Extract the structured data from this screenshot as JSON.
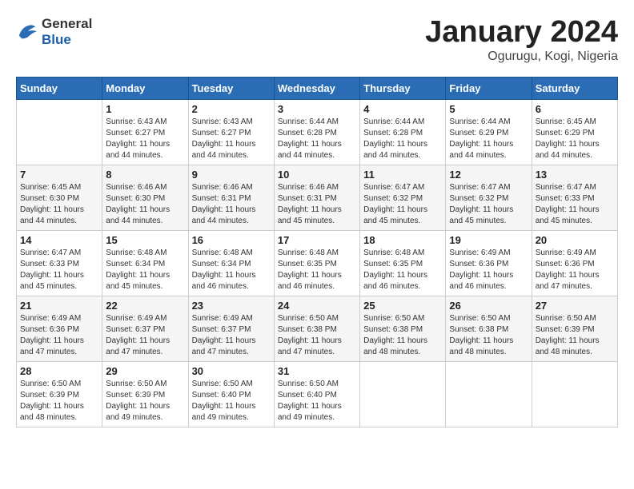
{
  "header": {
    "logo_general": "General",
    "logo_blue": "Blue",
    "month_title": "January 2024",
    "location": "Ogurugu, Kogi, Nigeria"
  },
  "days_of_week": [
    "Sunday",
    "Monday",
    "Tuesday",
    "Wednesday",
    "Thursday",
    "Friday",
    "Saturday"
  ],
  "weeks": [
    [
      {
        "day": "",
        "info": ""
      },
      {
        "day": "1",
        "info": "Sunrise: 6:43 AM\nSunset: 6:27 PM\nDaylight: 11 hours\nand 44 minutes."
      },
      {
        "day": "2",
        "info": "Sunrise: 6:43 AM\nSunset: 6:27 PM\nDaylight: 11 hours\nand 44 minutes."
      },
      {
        "day": "3",
        "info": "Sunrise: 6:44 AM\nSunset: 6:28 PM\nDaylight: 11 hours\nand 44 minutes."
      },
      {
        "day": "4",
        "info": "Sunrise: 6:44 AM\nSunset: 6:28 PM\nDaylight: 11 hours\nand 44 minutes."
      },
      {
        "day": "5",
        "info": "Sunrise: 6:44 AM\nSunset: 6:29 PM\nDaylight: 11 hours\nand 44 minutes."
      },
      {
        "day": "6",
        "info": "Sunrise: 6:45 AM\nSunset: 6:29 PM\nDaylight: 11 hours\nand 44 minutes."
      }
    ],
    [
      {
        "day": "7",
        "info": "Sunrise: 6:45 AM\nSunset: 6:30 PM\nDaylight: 11 hours\nand 44 minutes."
      },
      {
        "day": "8",
        "info": "Sunrise: 6:46 AM\nSunset: 6:30 PM\nDaylight: 11 hours\nand 44 minutes."
      },
      {
        "day": "9",
        "info": "Sunrise: 6:46 AM\nSunset: 6:31 PM\nDaylight: 11 hours\nand 44 minutes."
      },
      {
        "day": "10",
        "info": "Sunrise: 6:46 AM\nSunset: 6:31 PM\nDaylight: 11 hours\nand 45 minutes."
      },
      {
        "day": "11",
        "info": "Sunrise: 6:47 AM\nSunset: 6:32 PM\nDaylight: 11 hours\nand 45 minutes."
      },
      {
        "day": "12",
        "info": "Sunrise: 6:47 AM\nSunset: 6:32 PM\nDaylight: 11 hours\nand 45 minutes."
      },
      {
        "day": "13",
        "info": "Sunrise: 6:47 AM\nSunset: 6:33 PM\nDaylight: 11 hours\nand 45 minutes."
      }
    ],
    [
      {
        "day": "14",
        "info": "Sunrise: 6:47 AM\nSunset: 6:33 PM\nDaylight: 11 hours\nand 45 minutes."
      },
      {
        "day": "15",
        "info": "Sunrise: 6:48 AM\nSunset: 6:34 PM\nDaylight: 11 hours\nand 45 minutes."
      },
      {
        "day": "16",
        "info": "Sunrise: 6:48 AM\nSunset: 6:34 PM\nDaylight: 11 hours\nand 46 minutes."
      },
      {
        "day": "17",
        "info": "Sunrise: 6:48 AM\nSunset: 6:35 PM\nDaylight: 11 hours\nand 46 minutes."
      },
      {
        "day": "18",
        "info": "Sunrise: 6:48 AM\nSunset: 6:35 PM\nDaylight: 11 hours\nand 46 minutes."
      },
      {
        "day": "19",
        "info": "Sunrise: 6:49 AM\nSunset: 6:36 PM\nDaylight: 11 hours\nand 46 minutes."
      },
      {
        "day": "20",
        "info": "Sunrise: 6:49 AM\nSunset: 6:36 PM\nDaylight: 11 hours\nand 47 minutes."
      }
    ],
    [
      {
        "day": "21",
        "info": "Sunrise: 6:49 AM\nSunset: 6:36 PM\nDaylight: 11 hours\nand 47 minutes."
      },
      {
        "day": "22",
        "info": "Sunrise: 6:49 AM\nSunset: 6:37 PM\nDaylight: 11 hours\nand 47 minutes."
      },
      {
        "day": "23",
        "info": "Sunrise: 6:49 AM\nSunset: 6:37 PM\nDaylight: 11 hours\nand 47 minutes."
      },
      {
        "day": "24",
        "info": "Sunrise: 6:50 AM\nSunset: 6:38 PM\nDaylight: 11 hours\nand 47 minutes."
      },
      {
        "day": "25",
        "info": "Sunrise: 6:50 AM\nSunset: 6:38 PM\nDaylight: 11 hours\nand 48 minutes."
      },
      {
        "day": "26",
        "info": "Sunrise: 6:50 AM\nSunset: 6:38 PM\nDaylight: 11 hours\nand 48 minutes."
      },
      {
        "day": "27",
        "info": "Sunrise: 6:50 AM\nSunset: 6:39 PM\nDaylight: 11 hours\nand 48 minutes."
      }
    ],
    [
      {
        "day": "28",
        "info": "Sunrise: 6:50 AM\nSunset: 6:39 PM\nDaylight: 11 hours\nand 48 minutes."
      },
      {
        "day": "29",
        "info": "Sunrise: 6:50 AM\nSunset: 6:39 PM\nDaylight: 11 hours\nand 49 minutes."
      },
      {
        "day": "30",
        "info": "Sunrise: 6:50 AM\nSunset: 6:40 PM\nDaylight: 11 hours\nand 49 minutes."
      },
      {
        "day": "31",
        "info": "Sunrise: 6:50 AM\nSunset: 6:40 PM\nDaylight: 11 hours\nand 49 minutes."
      },
      {
        "day": "",
        "info": ""
      },
      {
        "day": "",
        "info": ""
      },
      {
        "day": "",
        "info": ""
      }
    ]
  ]
}
